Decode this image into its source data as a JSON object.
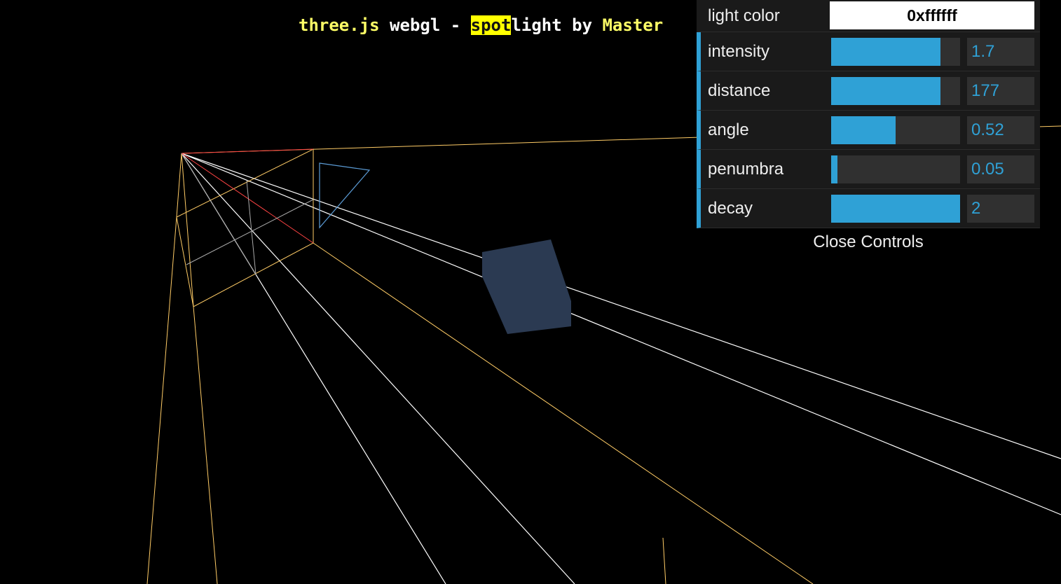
{
  "info": {
    "link1": "three.js",
    "mid": " webgl - ",
    "highlight": "spot",
    "rest": "light by ",
    "link2": "Master"
  },
  "controls": {
    "light_color": {
      "label": "light color",
      "value": "0xffffff"
    },
    "sliders": [
      {
        "label": "intensity",
        "value": "1.7",
        "fill": 0.85
      },
      {
        "label": "distance",
        "value": "177",
        "fill": 0.85
      },
      {
        "label": "angle",
        "value": "0.52",
        "fill": 0.5
      },
      {
        "label": "penumbra",
        "value": "0.05",
        "fill": 0.05
      },
      {
        "label": "decay",
        "value": "2",
        "fill": 1.0
      }
    ],
    "close_label": "Close Controls"
  },
  "colors": {
    "accent": "#2fa1d6",
    "link": "#ffff66",
    "highlight": "#ffff00",
    "cube": "#2b3a52"
  }
}
